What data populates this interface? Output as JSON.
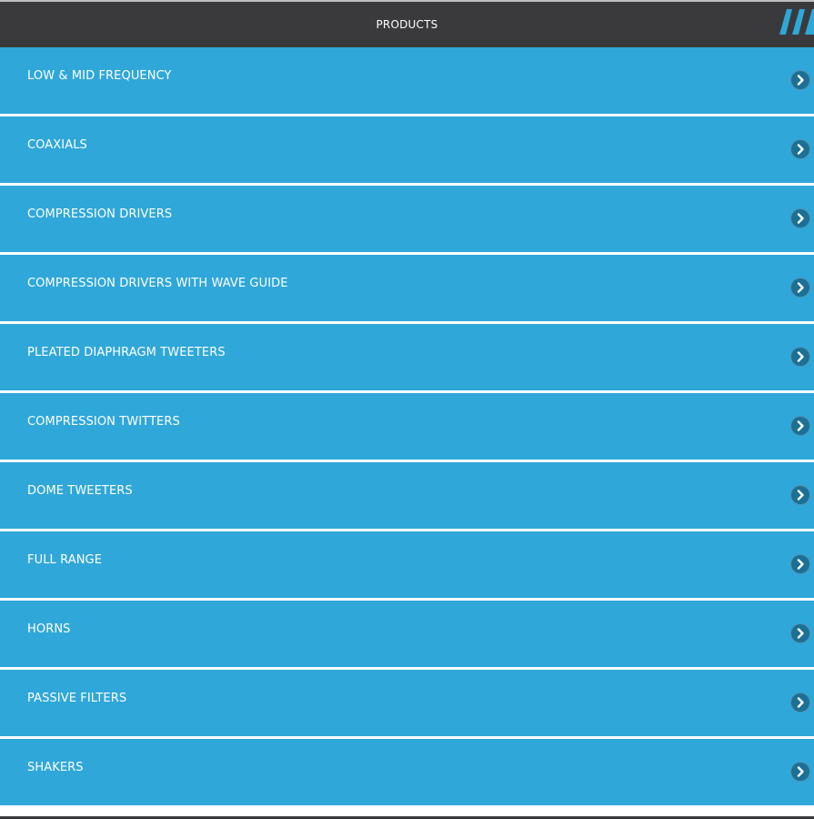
{
  "header": {
    "title": "PRODUCTS",
    "bar_color": "#3a3a3c",
    "logo_icon": "brand-quote-logo-icon"
  },
  "colors": {
    "row_background": "#2fa7d9",
    "row_separator": "#ffffff",
    "chevron_circle": "#1c6f95",
    "text": "#ffffff"
  },
  "products": {
    "items": [
      {
        "label": "LOW & MID FREQUENCY",
        "icon": "chevron-right-icon"
      },
      {
        "label": "COAXIALS",
        "icon": "chevron-right-icon"
      },
      {
        "label": "COMPRESSION DRIVERS",
        "icon": "chevron-right-icon"
      },
      {
        "label": "COMPRESSION DRIVERS WITH WAVE GUIDE",
        "icon": "chevron-right-icon"
      },
      {
        "label": "PLEATED DIAPHRAGM TWEETERS",
        "icon": "chevron-right-icon"
      },
      {
        "label": "COMPRESSION TWITTERS",
        "icon": "chevron-right-icon"
      },
      {
        "label": "DOME TWEETERS",
        "icon": "chevron-right-icon"
      },
      {
        "label": "FULL RANGE",
        "icon": "chevron-right-icon"
      },
      {
        "label": "HORNS",
        "icon": "chevron-right-icon"
      },
      {
        "label": "PASSIVE FILTERS",
        "icon": "chevron-right-icon"
      },
      {
        "label": "SHAKERS",
        "icon": "chevron-right-icon"
      }
    ]
  }
}
